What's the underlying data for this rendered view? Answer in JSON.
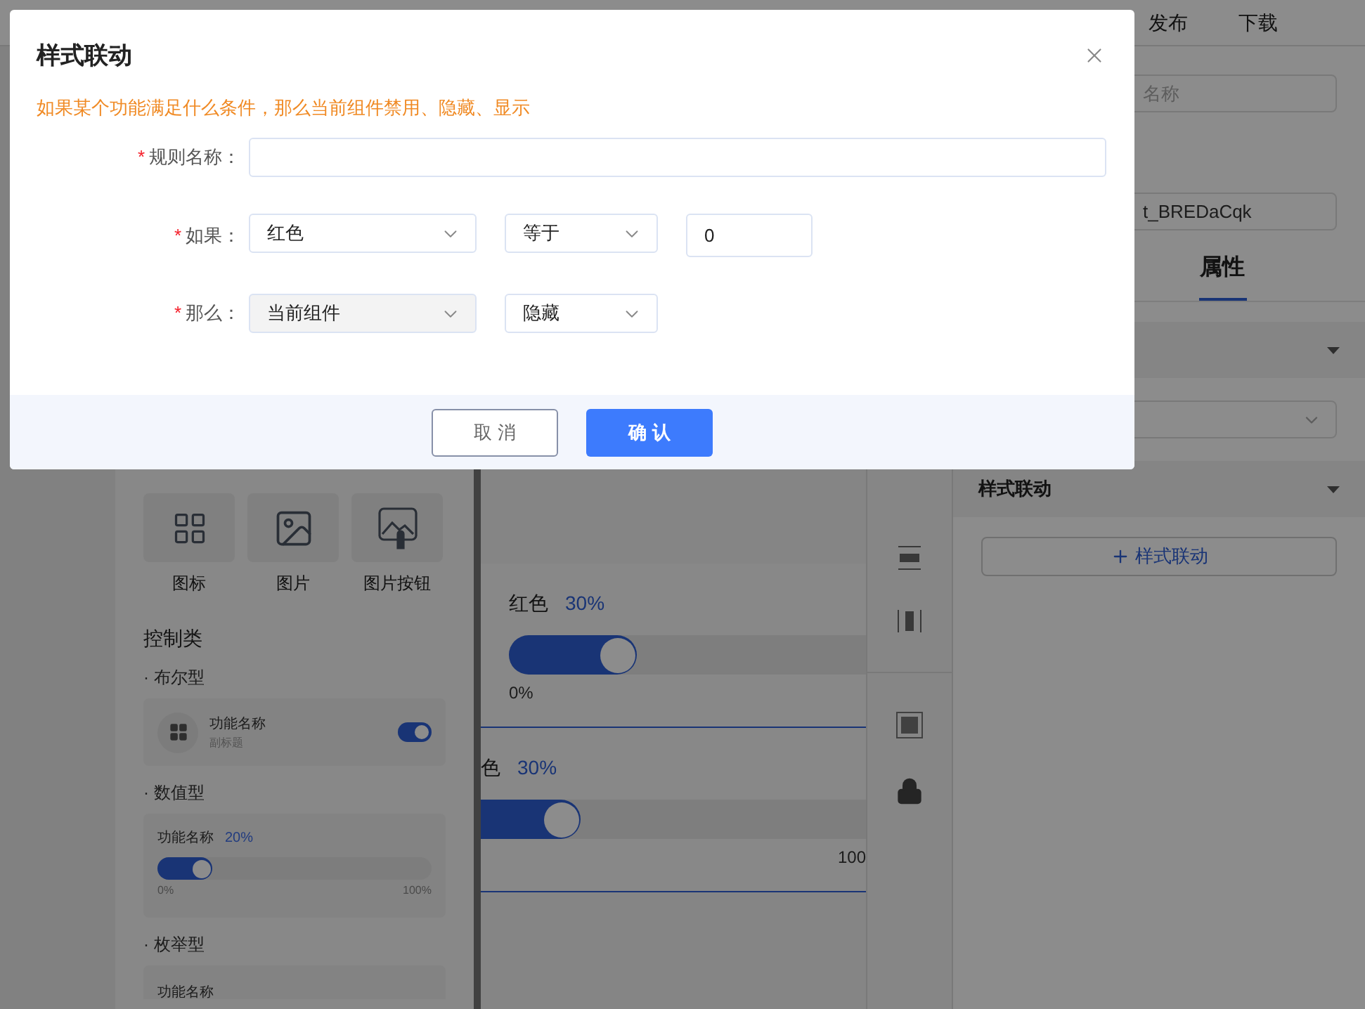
{
  "top_bar": {
    "items": [
      "发布",
      "下载"
    ]
  },
  "left_panel": {
    "tiles": [
      {
        "kind": "grid",
        "label": "图标"
      },
      {
        "kind": "image",
        "label": "图片"
      },
      {
        "kind": "image_button",
        "label": "图片按钮"
      }
    ],
    "section_title": "控制类",
    "groups": [
      {
        "kind": "boolean",
        "title": "· 布尔型",
        "name": "功能名称",
        "subtitle": "副标题",
        "on": true
      },
      {
        "kind": "numeric",
        "title": "· 数值型",
        "name": "功能名称",
        "value": "20%",
        "level": 0.2,
        "min": "0%",
        "max": "100%"
      },
      {
        "kind": "enum",
        "title": "· 枚举型",
        "name": "功能名称"
      }
    ]
  },
  "canvas": {
    "widgets": [
      {
        "kind": "full",
        "label": "红色",
        "value": "30%",
        "level": 0.36,
        "min": "0%"
      },
      {
        "kind": "cropped",
        "label": "色",
        "value": "30%",
        "level": 0.26,
        "max": "100"
      }
    ]
  },
  "right_panel": {
    "name_placeholder": "名称",
    "id_value": "t_BREDaCqk",
    "tabs": [
      {
        "label": "属性",
        "selected": true
      }
    ],
    "section_title": "样式联动",
    "add_button": "样式联动"
  },
  "dialog": {
    "title": "样式联动",
    "hint": "如果某个功能满足什么条件，那么当前组件禁用、隐藏、显示",
    "rows": [
      {
        "required_mark": "*",
        "label": "规则名称：",
        "controls": [
          {
            "kind": "input"
          }
        ]
      },
      {
        "required_mark": "*",
        "label": "如果：",
        "controls": [
          {
            "kind": "select",
            "value": "红色",
            "disabled": false
          },
          {
            "kind": "select",
            "value": "等于",
            "disabled": false
          },
          {
            "kind": "input",
            "value": "0"
          }
        ]
      },
      {
        "required_mark": "*",
        "label": "那么：",
        "controls": [
          {
            "kind": "select",
            "value": "当前组件",
            "disabled": true
          },
          {
            "kind": "select",
            "value": "隐藏",
            "disabled": false
          }
        ]
      }
    ],
    "buttons": [
      {
        "label": "取 消",
        "kind": "secondary"
      },
      {
        "label": "确 认",
        "kind": "primary"
      }
    ]
  }
}
